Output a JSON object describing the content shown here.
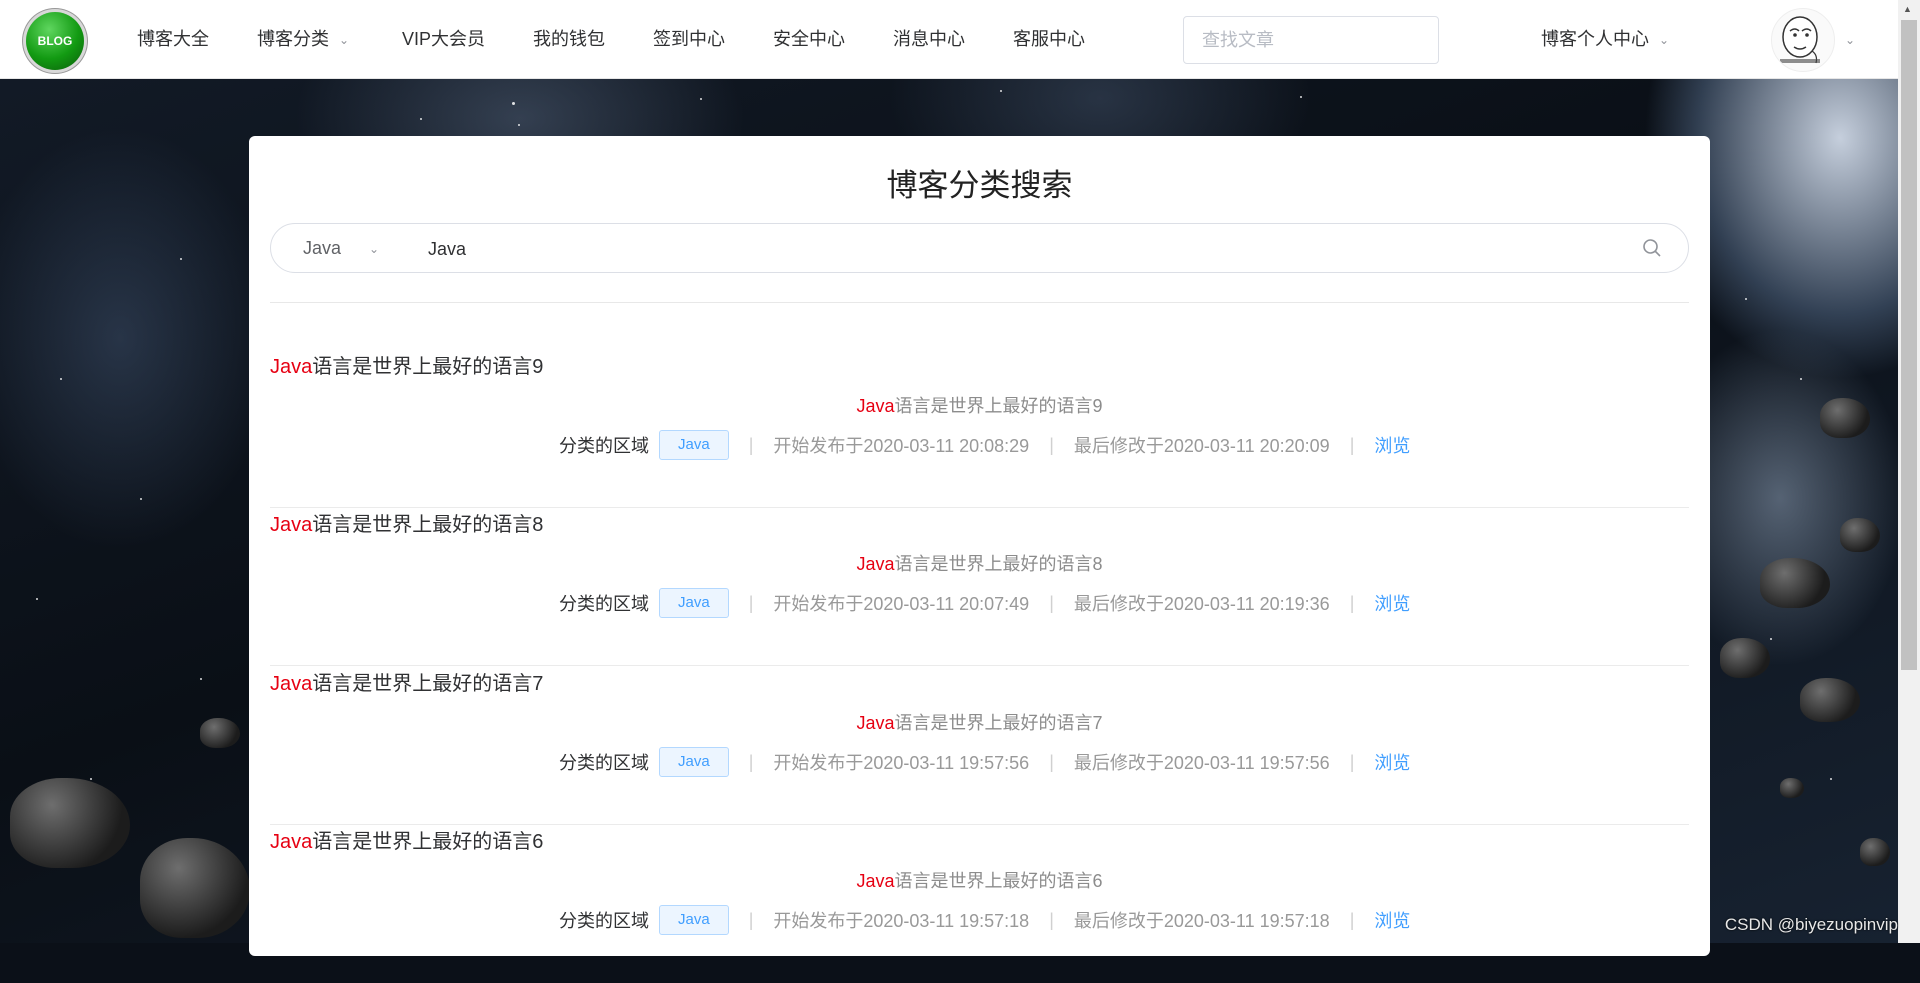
{
  "nav": {
    "logo_text": "BLOG",
    "items": [
      {
        "label": "博客大全"
      },
      {
        "label": "博客分类"
      },
      {
        "label": "VIP大会员"
      },
      {
        "label": "我的钱包"
      },
      {
        "label": "签到中心"
      },
      {
        "label": "安全中心"
      },
      {
        "label": "消息中心"
      },
      {
        "label": "客服中心"
      }
    ],
    "search_placeholder": "查找文章",
    "user_menu_label": "博客个人中心"
  },
  "page": {
    "title": "博客分类搜索",
    "search": {
      "category_selected": "Java",
      "query_value": "Java"
    }
  },
  "results": [
    {
      "keyword": "Java",
      "title_rest": "语言是世界上最好的语言9",
      "sub_keyword": "Java",
      "sub_rest": "语言是世界上最好的语言9",
      "category_label": "分类的区域",
      "tag": "Java",
      "published": "开始发布于2020-03-11 20:08:29",
      "modified": "最后修改于2020-03-11 20:20:09",
      "action": "浏览"
    },
    {
      "keyword": "Java",
      "title_rest": "语言是世界上最好的语言8",
      "sub_keyword": "Java",
      "sub_rest": "语言是世界上最好的语言8",
      "category_label": "分类的区域",
      "tag": "Java",
      "published": "开始发布于2020-03-11 20:07:49",
      "modified": "最后修改于2020-03-11 20:19:36",
      "action": "浏览"
    },
    {
      "keyword": "Java",
      "title_rest": "语言是世界上最好的语言7",
      "sub_keyword": "Java",
      "sub_rest": "语言是世界上最好的语言7",
      "category_label": "分类的区域",
      "tag": "Java",
      "published": "开始发布于2020-03-11 19:57:56",
      "modified": "最后修改于2020-03-11 19:57:56",
      "action": "浏览"
    },
    {
      "keyword": "Java",
      "title_rest": "语言是世界上最好的语言6",
      "sub_keyword": "Java",
      "sub_rest": "语言是世界上最好的语言6",
      "category_label": "分类的区域",
      "tag": "Java",
      "published": "开始发布于2020-03-11 19:57:18",
      "modified": "最后修改于2020-03-11 19:57:18",
      "action": "浏览"
    }
  ],
  "watermark": "CSDN @biyezuopinvip",
  "colors": {
    "keyword": "#e60012",
    "link": "#409eff",
    "logo_green": "#129a12"
  }
}
